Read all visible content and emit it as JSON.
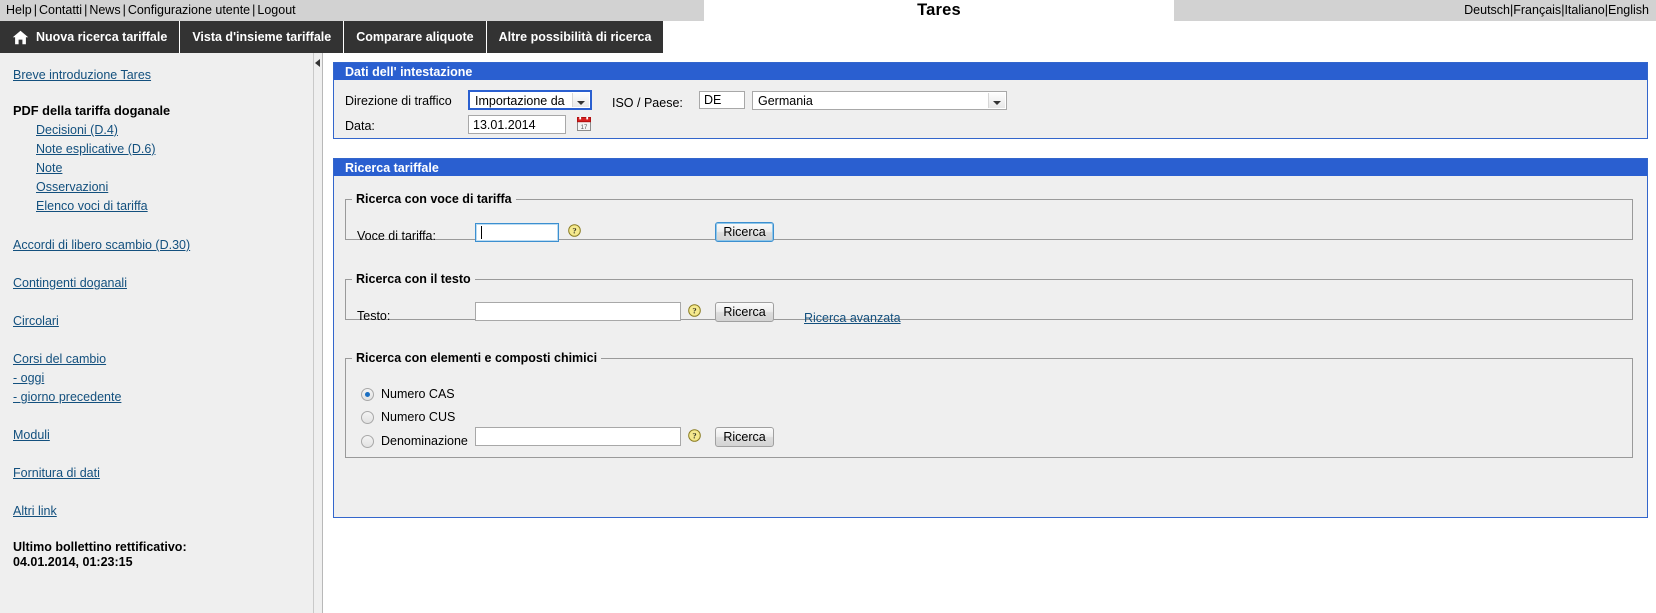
{
  "topbar": {
    "links": [
      "Help",
      "Contatti",
      "News",
      "Configurazione utente",
      "Logout"
    ],
    "separator": "|",
    "app_title": "Tares",
    "languages": [
      "Deutsch",
      "Français",
      "Italiano",
      "English"
    ]
  },
  "nav": {
    "tabs": [
      {
        "label": "Nuova ricerca tariffale",
        "icon": "home-icon",
        "active": true
      },
      {
        "label": "Vista d'insieme tariffale",
        "icon": "",
        "active": false
      },
      {
        "label": "Comparare aliquote",
        "icon": "",
        "active": false
      },
      {
        "label": "Altre possibilità di ricerca",
        "icon": "",
        "active": false
      }
    ]
  },
  "sidebar": {
    "intro_link": "Breve introduzione Tares",
    "pdf_group_title": "PDF della tariffa doganale",
    "pdf_links": [
      "Decisioni (D.4)",
      "Note esplicative (D.6)",
      "Note",
      "Osservazioni",
      "Elenco voci di tariffa"
    ],
    "links": [
      "Accordi di libero scambio (D.30)",
      "Contingenti doganali",
      "Circolari",
      "Corsi del cambio",
      "- oggi",
      "- giorno precedente",
      "Moduli",
      "Fornitura di dati",
      "Altri link"
    ],
    "bulletin_label": "Ultimo bollettino rettificativo:",
    "bulletin_value": "04.01.2014, 01:23:15"
  },
  "header_panel": {
    "title": "Dati dell' intestazione",
    "traffic_direction_label": "Direzione di traffico",
    "traffic_direction_value": "Importazione da",
    "iso_country_label": "ISO / Paese:",
    "iso_value": "DE",
    "country_value": "Germania",
    "date_label": "Data:",
    "date_value": "13.01.2014",
    "calendar_icon": "calendar-icon"
  },
  "search_panel": {
    "title": "Ricerca tariffale",
    "tariff_section": {
      "legend": "Ricerca con voce di tariffa",
      "field_label": "Voce di tariffa:",
      "field_value": "",
      "help_icon": "help-icon",
      "button_label": "Ricerca"
    },
    "text_section": {
      "legend": "Ricerca con il testo",
      "field_label": "Testo:",
      "field_value": "",
      "help_icon": "help-icon",
      "button_label": "Ricerca",
      "advanced_link": "Ricerca avanzata"
    },
    "chemical_section": {
      "legend": "Ricerca con elementi e composti chimici",
      "options": [
        {
          "label": "Numero CAS",
          "checked": true
        },
        {
          "label": "Numero CUS",
          "checked": false
        },
        {
          "label": "Denominazione",
          "checked": false
        }
      ],
      "denomination_value": "",
      "help_icon": "help-icon",
      "button_label": "Ricerca"
    }
  },
  "colors": {
    "panel_header_bg": "#2a5fd0",
    "nav_bg": "#333333",
    "link": "#13507e",
    "sidebar_bg": "#efefef",
    "topbar_bg": "#d2d2d2"
  }
}
